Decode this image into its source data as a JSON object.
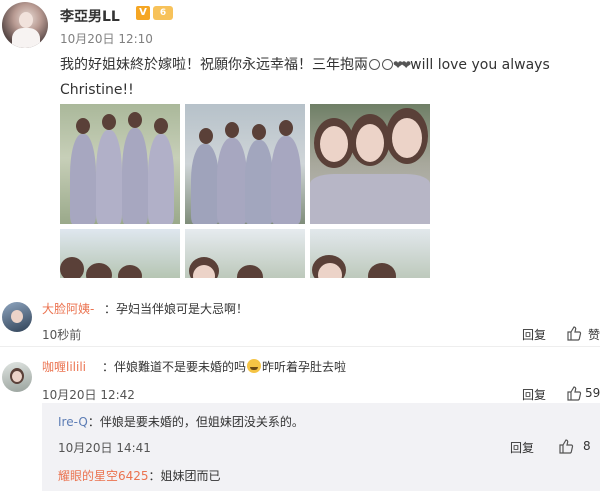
{
  "post": {
    "author": "李亞男LL",
    "vip_badge": "V",
    "level_badge": "6",
    "time": "10月20日 12:10",
    "text_line1": "我的好姐妹終於嫁啦！祝願你永远幸福！三年抱兩",
    "text_line1_end": "will love you always",
    "text_line2": "Christine!!",
    "icons": [
      "smile-icon",
      "smile-icon",
      "heart-icon",
      "heart-icon"
    ]
  },
  "comments": [
    {
      "name": "大脸阿姨-",
      "text": "：孕妇当伴娘可是大忌啊！",
      "time": "10秒前",
      "reply_label": "回复",
      "like_label": "赞"
    },
    {
      "name": "咖喱lilili",
      "text_before": "：伴娘難道不是要未婚的吗",
      "text_after": "昨听着孕肚去啦",
      "time": "10月20日 12:42",
      "reply_label": "回复",
      "like_count": "59"
    }
  ],
  "sub_replies": [
    {
      "name": "Ire-Q",
      "text": "：伴娘是要未婚的，但姐妹团没关系的。",
      "time": "10月20日 14:41",
      "reply_label": "回复",
      "like_count": "8"
    },
    {
      "name": "耀眼的星空6425",
      "text": "：姐妹团而已"
    }
  ],
  "colors": {
    "name": "#eb7350",
    "sub_name": "#5d7db5",
    "sub_bg": "#f2f2f5"
  }
}
